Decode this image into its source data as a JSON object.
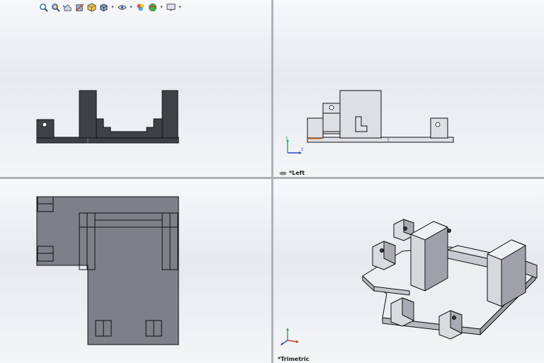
{
  "viewports": {
    "top_left": {
      "name": "front-view"
    },
    "top_right": {
      "name": "left-view",
      "label": "*Left"
    },
    "bottom_left": {
      "name": "top-view"
    },
    "bottom_right": {
      "name": "trimetric-view",
      "label": "*Trimetric"
    }
  },
  "hud_toolbar": {
    "icons": [
      "zoom-to-fit-icon",
      "zoom-to-area-icon",
      "previous-view-icon",
      "section-view-icon",
      "view-orientation-icon",
      "display-style-icon",
      "hide-show-items-icon",
      "edit-appearance-icon",
      "apply-scene-icon",
      "view-settings-icon"
    ]
  },
  "colors": {
    "viewport_bg": "#eef0f4",
    "dark_part": "#3f4147",
    "shaded_part": "#7d7f89",
    "light_part": "#dfe0e6",
    "edge": "#111111",
    "axis_x": "#c0392b",
    "axis_y": "#27ae60",
    "axis_z": "#2c47c8"
  }
}
